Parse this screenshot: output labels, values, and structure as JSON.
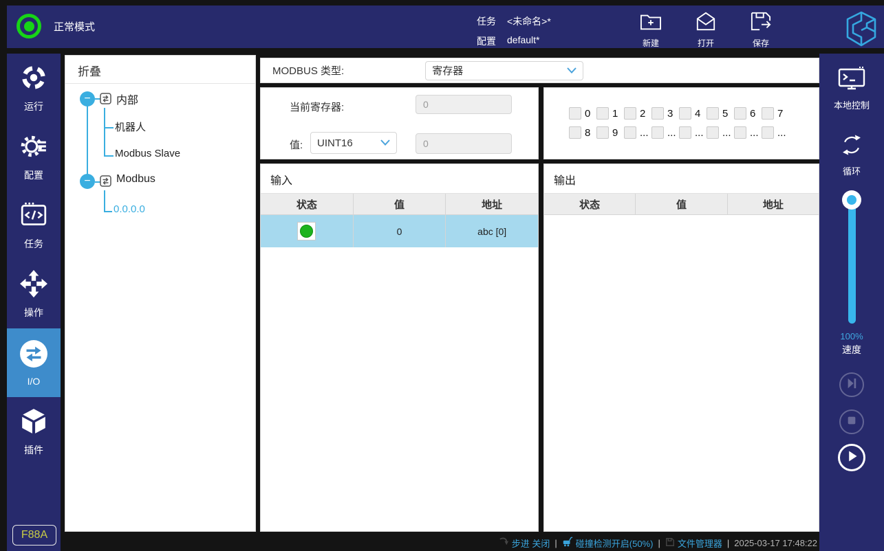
{
  "topbar": {
    "mode": "正常模式",
    "task_label": "任务",
    "task_value": "<未命名>*",
    "config_label": "配置",
    "config_value": "default*",
    "actions": [
      {
        "label": "新建"
      },
      {
        "label": "打开"
      },
      {
        "label": "保存"
      }
    ]
  },
  "sidebar": {
    "items": [
      {
        "label": "运行"
      },
      {
        "label": "配置"
      },
      {
        "label": "任务"
      },
      {
        "label": "操作"
      },
      {
        "label": "I/O"
      },
      {
        "label": "插件"
      }
    ],
    "badge": "F88A"
  },
  "tree": {
    "header": "折叠",
    "node1": "内部",
    "node1_children": [
      "机器人",
      "Modbus Slave"
    ],
    "node2": "Modbus",
    "node2_child": "0.0.0.0"
  },
  "modbus": {
    "type_label": "MODBUS 类型:",
    "type_value": "寄存器",
    "reg_label": "当前寄存器:",
    "reg_value": "0",
    "val_label": "值:",
    "val_type": "UINT16",
    "val_value": "0"
  },
  "bits": {
    "cells": [
      "0",
      "1",
      "2",
      "3",
      "4",
      "5",
      "6",
      "7",
      "8",
      "9",
      "...",
      "...",
      "...",
      "...",
      "...",
      "..."
    ]
  },
  "input_table": {
    "title": "输入",
    "headers": [
      "状态",
      "值",
      "地址"
    ],
    "row": {
      "status": "on",
      "value": "0",
      "address": "abc [0]"
    }
  },
  "output_table": {
    "title": "输出",
    "headers": [
      "状态",
      "值",
      "地址"
    ]
  },
  "rightbar": {
    "local_control": "本地控制",
    "loop": "循环",
    "speed_value": "100%",
    "speed_label": "速度"
  },
  "statusbar": {
    "step": "步进 关闭",
    "collision": "碰撞检测开启(50%)",
    "files": "文件管理器",
    "time": "2025-03-17 17:48:22"
  },
  "colors": {
    "navy": "#272a6c",
    "accent_blue": "#35aade",
    "active_blue": "#3e8ccb",
    "green": "#17d417",
    "selected_row": "#a6d9ee",
    "status_blue": "#3aa4dc",
    "badge_yellow": "#c9cd45"
  }
}
